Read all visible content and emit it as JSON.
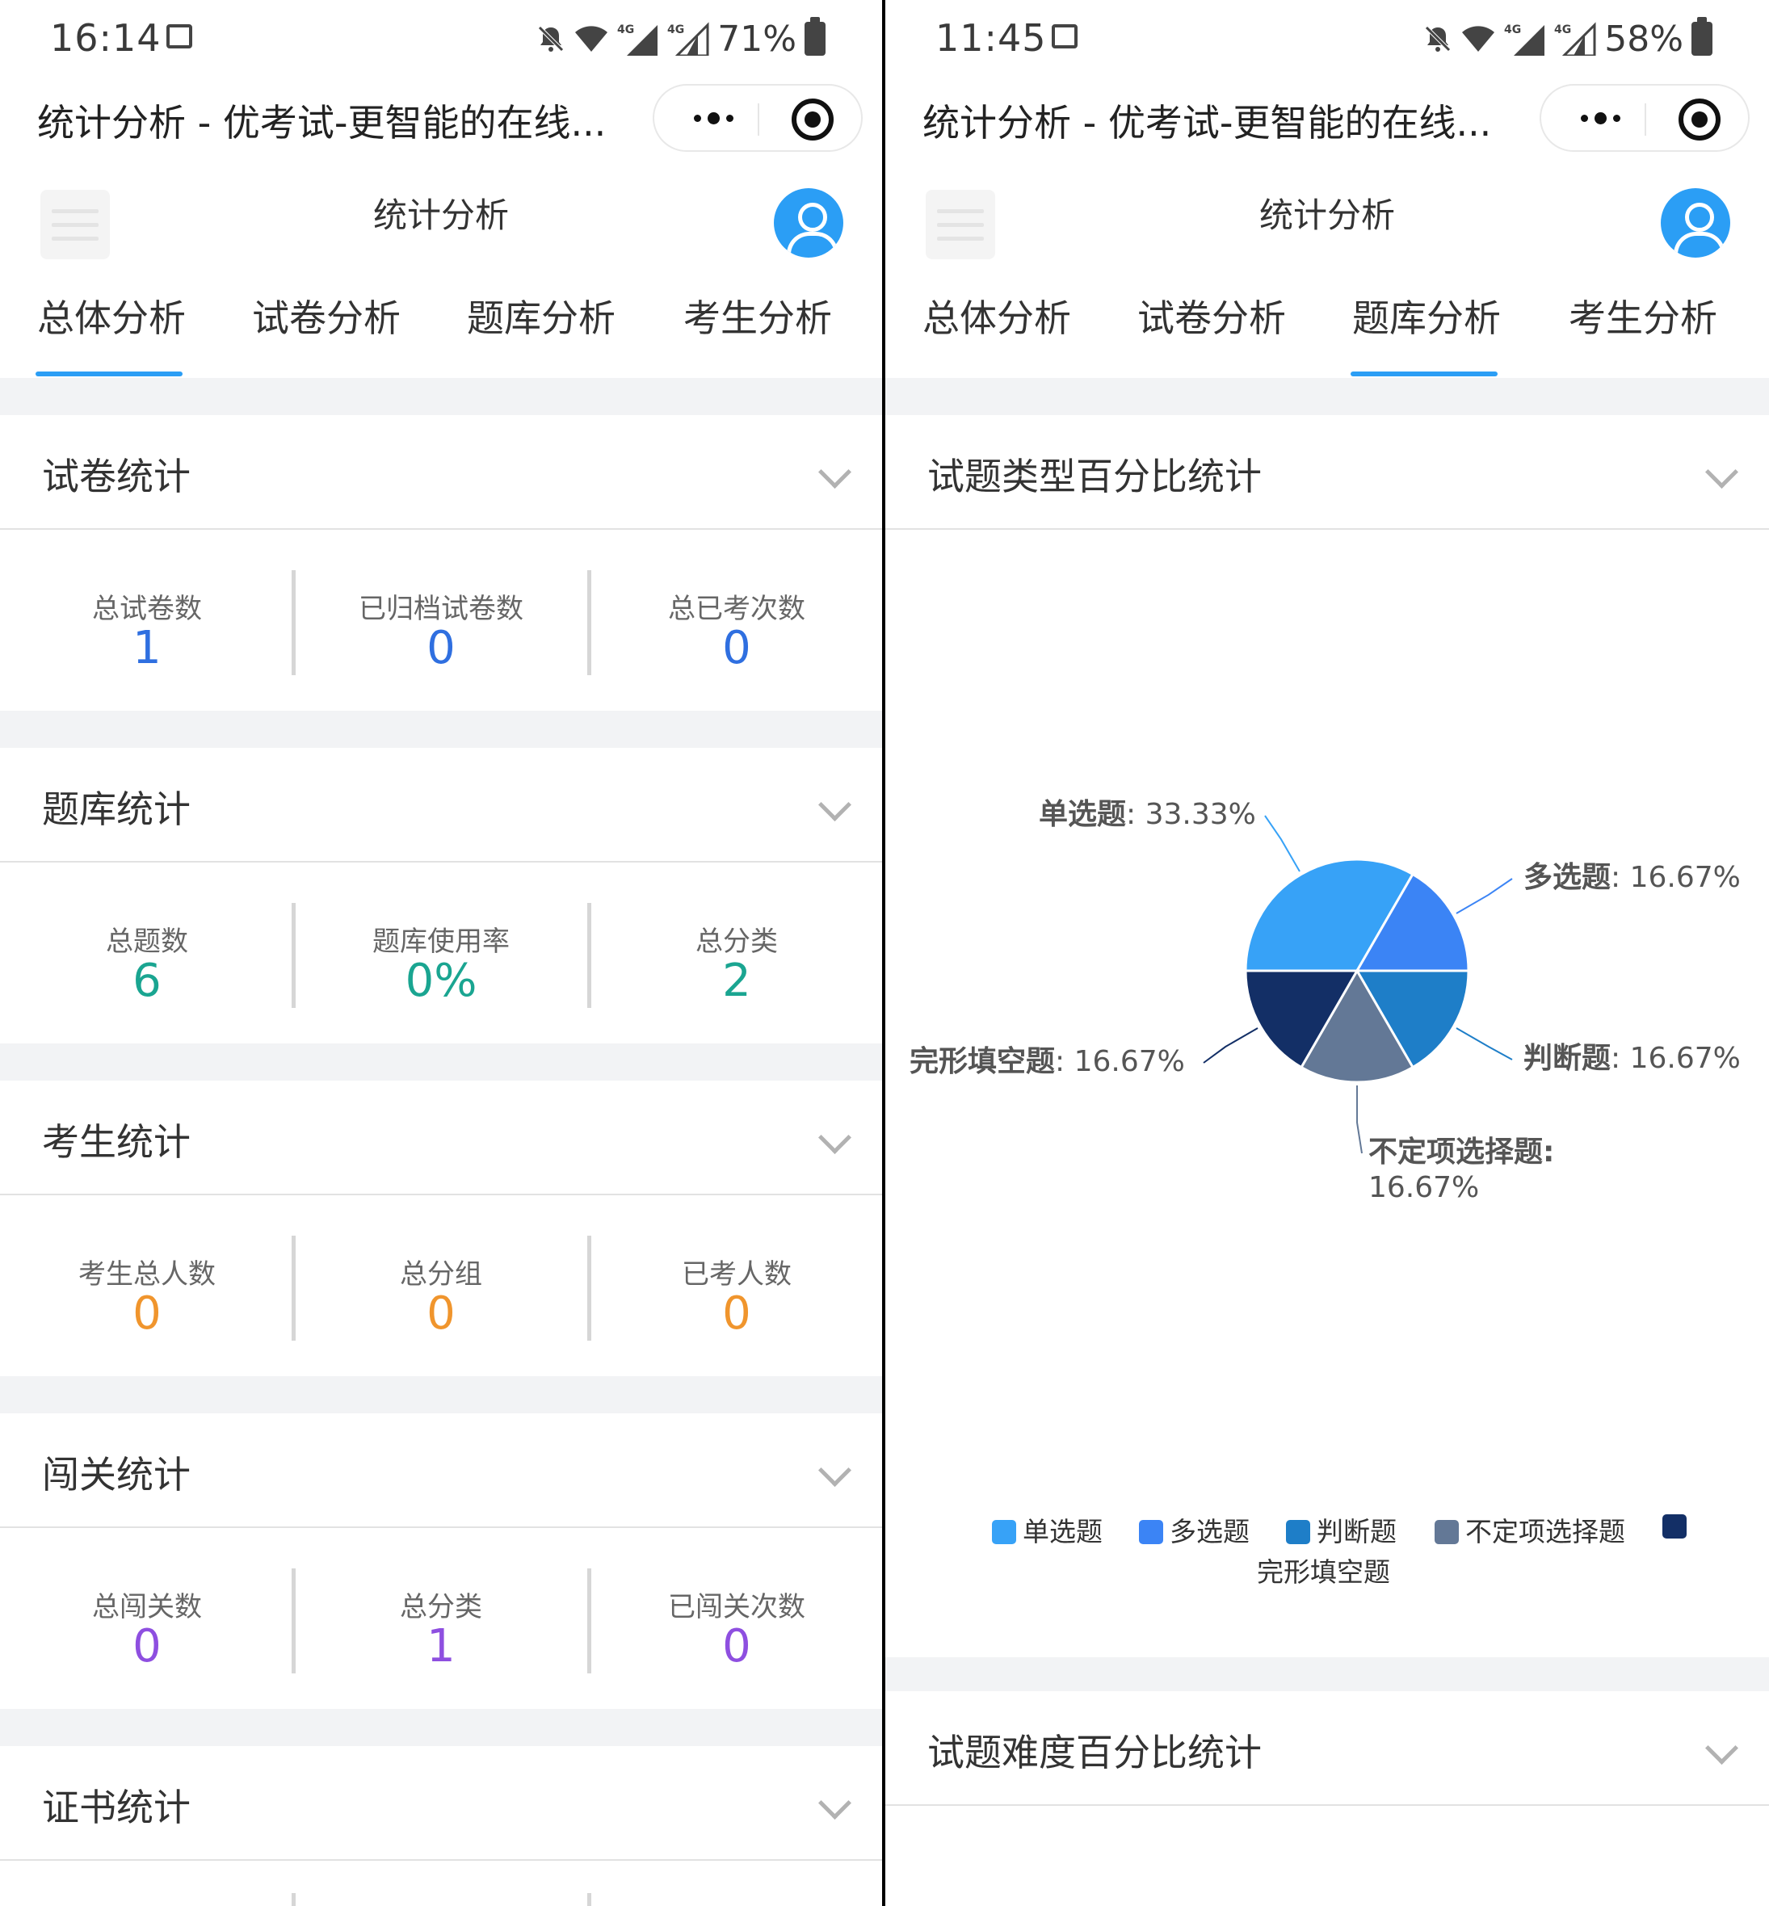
{
  "left": {
    "status": {
      "time": "16:14",
      "battery": "71%"
    },
    "app_title": "统计分析 - 优考试-更智能的在线...",
    "header_title": "统计分析",
    "tabs": [
      "总体分析",
      "试卷分析",
      "题库分析",
      "考生分析"
    ],
    "active_tab": 0,
    "sections": [
      {
        "title": "试卷统计",
        "value_color": "#2f6fe0",
        "stats": [
          {
            "label": "总试卷数",
            "value": "1"
          },
          {
            "label": "已归档试卷数",
            "value": "0"
          },
          {
            "label": "总已考次数",
            "value": "0"
          }
        ]
      },
      {
        "title": "题库统计",
        "value_color": "#1aa591",
        "stats": [
          {
            "label": "总题数",
            "value": "6"
          },
          {
            "label": "题库使用率",
            "value": "0%"
          },
          {
            "label": "总分类",
            "value": "2"
          }
        ]
      },
      {
        "title": "考生统计",
        "value_color": "#f0952d",
        "stats": [
          {
            "label": "考生总人数",
            "value": "0"
          },
          {
            "label": "总分组",
            "value": "0"
          },
          {
            "label": "已考人数",
            "value": "0"
          }
        ]
      },
      {
        "title": "闯关统计",
        "value_color": "#8e4fe0",
        "stats": [
          {
            "label": "总闯关数",
            "value": "0"
          },
          {
            "label": "总分类",
            "value": "1"
          },
          {
            "label": "已闯关次数",
            "value": "0"
          }
        ]
      },
      {
        "title": "证书统计"
      }
    ]
  },
  "right": {
    "status": {
      "time": "11:45",
      "battery": "58%"
    },
    "app_title": "统计分析 - 优考试-更智能的在线...",
    "header_title": "统计分析",
    "tabs": [
      "总体分析",
      "试卷分析",
      "题库分析",
      "考生分析"
    ],
    "active_tab": 2,
    "section1_title": "试题类型百分比统计",
    "section2_title": "试题难度百分比统计",
    "colors": {
      "accent": "#2b9ef5"
    }
  },
  "chart_data": {
    "type": "pie",
    "series": [
      {
        "name": "单选题",
        "value": 33.33,
        "label": "33.33%",
        "color": "#37a2f7"
      },
      {
        "name": "多选题",
        "value": 16.67,
        "label": "16.67%",
        "color": "#3b84f5"
      },
      {
        "name": "判断题",
        "value": 16.67,
        "label": "16.67%",
        "color": "#1e7ec8"
      },
      {
        "name": "不定项选择题",
        "value": 16.67,
        "label": "16.67%",
        "color": "#637896"
      },
      {
        "name": "完形填空题",
        "value": 16.67,
        "label": "16.67%",
        "color": "#132f66"
      }
    ],
    "legend_position": "bottom"
  }
}
